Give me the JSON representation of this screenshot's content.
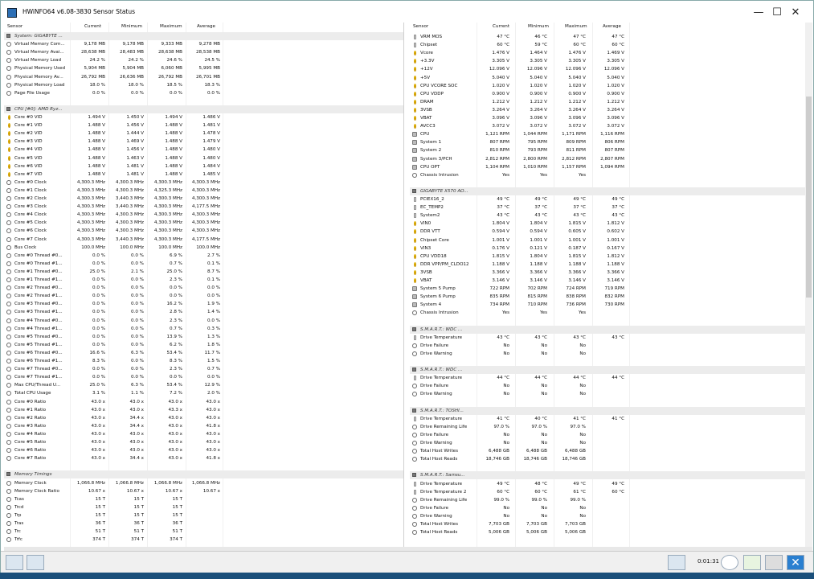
{
  "window": {
    "title": "HWiNFO64 v6.08-3830 Sensor Status",
    "min": "—",
    "max": "☐",
    "close": "✕"
  },
  "headers": [
    "Sensor",
    "Current",
    "Minimum",
    "Maximum",
    "Average"
  ],
  "left": [
    [
      "g",
      "System: GIGABYTE ..."
    ],
    [
      "c",
      "Virtual Memory Com...",
      "9,178 MB",
      "9,178 MB",
      "9,333 MB",
      "9,278 MB"
    ],
    [
      "c",
      "Virtual Memory Avai...",
      "28,638 MB",
      "28,483 MB",
      "28,638 MB",
      "28,538 MB"
    ],
    [
      "c",
      "Virtual Memory Load",
      "24.2 %",
      "24.2 %",
      "24.6 %",
      "24.5 %"
    ],
    [
      "c",
      "Physical Memory Used",
      "5,904 MB",
      "5,904 MB",
      "6,060 MB",
      "5,995 MB"
    ],
    [
      "c",
      "Physical Memory Av...",
      "26,792 MB",
      "26,636 MB",
      "26,792 MB",
      "26,701 MB"
    ],
    [
      "c",
      "Physical Memory Load",
      "18.0 %",
      "18.0 %",
      "18.5 %",
      "18.3 %"
    ],
    [
      "c",
      "Page File Usage",
      "0.0 %",
      "0.0 %",
      "0.0 %",
      "0.0 %"
    ],
    [
      "b"
    ],
    [
      "g",
      "CPU [#0]: AMD Ryz..."
    ],
    [
      "v",
      "Core #0 VID",
      "1.494 V",
      "1.450 V",
      "1.494 V",
      "1.486 V"
    ],
    [
      "v",
      "Core #1 VID",
      "1.488 V",
      "1.456 V",
      "1.488 V",
      "1.481 V"
    ],
    [
      "v",
      "Core #2 VID",
      "1.488 V",
      "1.444 V",
      "1.488 V",
      "1.478 V"
    ],
    [
      "v",
      "Core #3 VID",
      "1.488 V",
      "1.469 V",
      "1.488 V",
      "1.479 V"
    ],
    [
      "v",
      "Core #4 VID",
      "1.488 V",
      "1.456 V",
      "1.488 V",
      "1.480 V"
    ],
    [
      "v",
      "Core #5 VID",
      "1.488 V",
      "1.463 V",
      "1.488 V",
      "1.480 V"
    ],
    [
      "v",
      "Core #6 VID",
      "1.488 V",
      "1.481 V",
      "1.488 V",
      "1.484 V"
    ],
    [
      "v",
      "Core #7 VID",
      "1.488 V",
      "1.481 V",
      "1.488 V",
      "1.485 V"
    ],
    [
      "c",
      "Core #0 Clock",
      "4,300.3 MHz",
      "4,300.3 MHz",
      "4,300.3 MHz",
      "4,300.3 MHz"
    ],
    [
      "c",
      "Core #1 Clock",
      "4,300.3 MHz",
      "4,300.3 MHz",
      "4,325.3 MHz",
      "4,300.3 MHz"
    ],
    [
      "c",
      "Core #2 Clock",
      "4,300.3 MHz",
      "3,440.3 MHz",
      "4,300.3 MHz",
      "4,300.3 MHz"
    ],
    [
      "c",
      "Core #3 Clock",
      "4,300.3 MHz",
      "3,440.3 MHz",
      "4,300.3 MHz",
      "4,177.5 MHz"
    ],
    [
      "c",
      "Core #4 Clock",
      "4,300.3 MHz",
      "4,300.3 MHz",
      "4,300.3 MHz",
      "4,300.3 MHz"
    ],
    [
      "c",
      "Core #5 Clock",
      "4,300.3 MHz",
      "4,300.3 MHz",
      "4,300.3 MHz",
      "4,300.3 MHz"
    ],
    [
      "c",
      "Core #6 Clock",
      "4,300.3 MHz",
      "4,300.3 MHz",
      "4,300.3 MHz",
      "4,300.3 MHz"
    ],
    [
      "c",
      "Core #7 Clock",
      "4,300.3 MHz",
      "3,440.3 MHz",
      "4,300.3 MHz",
      "4,177.5 MHz"
    ],
    [
      "c",
      "Bus Clock",
      "100.0 MHz",
      "100.0 MHz",
      "100.0 MHz",
      "100.0 MHz"
    ],
    [
      "c",
      "Core #0 Thread #0...",
      "0.0 %",
      "0.0 %",
      "6.9 %",
      "2.7 %"
    ],
    [
      "c",
      "Core #0 Thread #1...",
      "0.0 %",
      "0.0 %",
      "0.7 %",
      "0.1 %"
    ],
    [
      "c",
      "Core #1 Thread #0...",
      "25.0 %",
      "2.1 %",
      "25.0 %",
      "8.7 %"
    ],
    [
      "c",
      "Core #1 Thread #1...",
      "0.0 %",
      "0.0 %",
      "2.3 %",
      "0.1 %"
    ],
    [
      "c",
      "Core #2 Thread #0...",
      "0.0 %",
      "0.0 %",
      "0.0 %",
      "0.0 %"
    ],
    [
      "c",
      "Core #2 Thread #1...",
      "0.0 %",
      "0.0 %",
      "0.0 %",
      "0.0 %"
    ],
    [
      "c",
      "Core #3 Thread #0...",
      "0.0 %",
      "0.0 %",
      "16.2 %",
      "1.9 %"
    ],
    [
      "c",
      "Core #3 Thread #1...",
      "0.0 %",
      "0.0 %",
      "2.8 %",
      "1.4 %"
    ],
    [
      "c",
      "Core #4 Thread #0...",
      "0.0 %",
      "0.0 %",
      "2.3 %",
      "0.0 %"
    ],
    [
      "c",
      "Core #4 Thread #1...",
      "0.0 %",
      "0.0 %",
      "0.7 %",
      "0.3 %"
    ],
    [
      "c",
      "Core #5 Thread #0...",
      "0.0 %",
      "0.0 %",
      "13.9 %",
      "1.3 %"
    ],
    [
      "c",
      "Core #5 Thread #1...",
      "0.0 %",
      "0.0 %",
      "6.2 %",
      "1.8 %"
    ],
    [
      "c",
      "Core #6 Thread #0...",
      "16.6 %",
      "6.3 %",
      "53.4 %",
      "11.7 %"
    ],
    [
      "c",
      "Core #6 Thread #1...",
      "8.3 %",
      "0.0 %",
      "8.3 %",
      "1.5 %"
    ],
    [
      "c",
      "Core #7 Thread #0...",
      "0.0 %",
      "0.0 %",
      "2.3 %",
      "0.7 %"
    ],
    [
      "c",
      "Core #7 Thread #1...",
      "0.0 %",
      "0.0 %",
      "0.0 %",
      "0.0 %"
    ],
    [
      "c",
      "Max CPU/Thread U...",
      "25.0 %",
      "6.3 %",
      "53.4 %",
      "12.9 %"
    ],
    [
      "c",
      "Total CPU Usage",
      "3.1 %",
      "1.1 %",
      "7.2 %",
      "2.0 %"
    ],
    [
      "c",
      "Core #0 Ratio",
      "43.0 x",
      "43.0 x",
      "43.0 x",
      "43.0 x"
    ],
    [
      "c",
      "Core #1 Ratio",
      "43.0 x",
      "43.0 x",
      "43.3 x",
      "43.0 x"
    ],
    [
      "c",
      "Core #2 Ratio",
      "43.0 x",
      "34.4 x",
      "43.0 x",
      "43.0 x"
    ],
    [
      "c",
      "Core #3 Ratio",
      "43.0 x",
      "34.4 x",
      "43.0 x",
      "41.8 x"
    ],
    [
      "c",
      "Core #4 Ratio",
      "43.0 x",
      "43.0 x",
      "43.0 x",
      "43.0 x"
    ],
    [
      "c",
      "Core #5 Ratio",
      "43.0 x",
      "43.0 x",
      "43.0 x",
      "43.0 x"
    ],
    [
      "c",
      "Core #6 Ratio",
      "43.0 x",
      "43.0 x",
      "43.0 x",
      "43.0 x"
    ],
    [
      "c",
      "Core #7 Ratio",
      "43.0 x",
      "34.4 x",
      "43.0 x",
      "41.8 x"
    ],
    [
      "b"
    ],
    [
      "g",
      "Memory Timings"
    ],
    [
      "c",
      "Memory Clock",
      "1,066.8 MHz",
      "1,066.8 MHz",
      "1,066.8 MHz",
      "1,066.8 MHz"
    ],
    [
      "c",
      "Memory Clock Ratio",
      "10.67 x",
      "10.67 x",
      "10.67 x",
      "10.67 x"
    ],
    [
      "c",
      "Tcas",
      "15 T",
      "15 T",
      "15 T",
      ""
    ],
    [
      "c",
      "Trcd",
      "15 T",
      "15 T",
      "15 T",
      ""
    ],
    [
      "c",
      "Trp",
      "15 T",
      "15 T",
      "15 T",
      ""
    ],
    [
      "c",
      "Tras",
      "36 T",
      "36 T",
      "36 T",
      ""
    ],
    [
      "c",
      "Trc",
      "51 T",
      "51 T",
      "51 T",
      ""
    ],
    [
      "c",
      "Trfc",
      "374 T",
      "374 T",
      "374 T",
      ""
    ]
  ],
  "right": [
    [
      "t",
      "VRM MOS",
      "47 °C",
      "46 °C",
      "47 °C",
      "47 °C"
    ],
    [
      "t",
      "Chipset",
      "60 °C",
      "59 °C",
      "60 °C",
      "60 °C"
    ],
    [
      "v",
      "Vcore",
      "1.476 V",
      "1.464 V",
      "1.476 V",
      "1.469 V"
    ],
    [
      "v",
      "+3.3V",
      "3.305 V",
      "3.305 V",
      "3.305 V",
      "3.305 V"
    ],
    [
      "v",
      "+12V",
      "12.096 V",
      "12.096 V",
      "12.096 V",
      "12.096 V"
    ],
    [
      "v",
      "+5V",
      "5.040 V",
      "5.040 V",
      "5.040 V",
      "5.040 V"
    ],
    [
      "v",
      "CPU VCORE SOC",
      "1.020 V",
      "1.020 V",
      "1.020 V",
      "1.020 V"
    ],
    [
      "v",
      "CPU VDDP",
      "0.900 V",
      "0.900 V",
      "0.900 V",
      "0.900 V"
    ],
    [
      "v",
      "DRAM",
      "1.212 V",
      "1.212 V",
      "1.212 V",
      "1.212 V"
    ],
    [
      "v",
      "3VSB",
      "3.264 V",
      "3.264 V",
      "3.264 V",
      "3.264 V"
    ],
    [
      "v",
      "VBAT",
      "3.096 V",
      "3.096 V",
      "3.096 V",
      "3.096 V"
    ],
    [
      "v",
      "AVCC3",
      "3.072 V",
      "3.072 V",
      "3.072 V",
      "3.072 V"
    ],
    [
      "f",
      "CPU",
      "1,121 RPM",
      "1,044 RPM",
      "1,171 RPM",
      "1,116 RPM"
    ],
    [
      "f",
      "System 1",
      "807 RPM",
      "795 RPM",
      "809 RPM",
      "806 RPM"
    ],
    [
      "f",
      "System 2",
      "810 RPM",
      "793 RPM",
      "811 RPM",
      "807 RPM"
    ],
    [
      "f",
      "System 3/PCH",
      "2,812 RPM",
      "2,800 RPM",
      "2,812 RPM",
      "2,807 RPM"
    ],
    [
      "f",
      "CPU OPT",
      "1,104 RPM",
      "1,010 RPM",
      "1,157 RPM",
      "1,094 RPM"
    ],
    [
      "c",
      "Chassis Intrusion",
      "Yes",
      "Yes",
      "Yes",
      ""
    ],
    [
      "b"
    ],
    [
      "g",
      "GIGABYTE X570 AO..."
    ],
    [
      "t",
      "PCIEX16_2",
      "49 °C",
      "49 °C",
      "49 °C",
      "49 °C"
    ],
    [
      "t",
      "EC_TEMP2",
      "37 °C",
      "37 °C",
      "37 °C",
      "37 °C"
    ],
    [
      "t",
      "System2",
      "43 °C",
      "43 °C",
      "43 °C",
      "43 °C"
    ],
    [
      "v",
      "VIN0",
      "1.804 V",
      "1.804 V",
      "1.815 V",
      "1.812 V"
    ],
    [
      "v",
      "DDR VTT",
      "0.594 V",
      "0.594 V",
      "0.605 V",
      "0.602 V"
    ],
    [
      "v",
      "Chipset Core",
      "1.001 V",
      "1.001 V",
      "1.001 V",
      "1.001 V"
    ],
    [
      "v",
      "VIN3",
      "0.176 V",
      "0.121 V",
      "0.187 V",
      "0.167 V"
    ],
    [
      "v",
      "CPU VDD18",
      "1.815 V",
      "1.804 V",
      "1.815 V",
      "1.812 V"
    ],
    [
      "v",
      "DDR VPP/PM_CLDO12",
      "1.188 V",
      "1.188 V",
      "1.188 V",
      "1.188 V"
    ],
    [
      "v",
      "3VSB",
      "3.366 V",
      "3.366 V",
      "3.366 V",
      "3.366 V"
    ],
    [
      "v",
      "VBAT",
      "3.146 V",
      "3.146 V",
      "3.146 V",
      "3.146 V"
    ],
    [
      "f",
      "System 5 Pump",
      "722 RPM",
      "702 RPM",
      "724 RPM",
      "719 RPM"
    ],
    [
      "f",
      "System 6 Pump",
      "835 RPM",
      "815 RPM",
      "838 RPM",
      "832 RPM"
    ],
    [
      "f",
      "System 4",
      "734 RPM",
      "710 RPM",
      "736 RPM",
      "730 RPM"
    ],
    [
      "c",
      "Chassis Intrusion",
      "Yes",
      "Yes",
      "Yes",
      ""
    ],
    [
      "b"
    ],
    [
      "g",
      "S.M.A.R.T.: WDC ..."
    ],
    [
      "t",
      "Drive Temperature",
      "43 °C",
      "43 °C",
      "43 °C",
      "43 °C"
    ],
    [
      "c",
      "Drive Failure",
      "No",
      "No",
      "No",
      ""
    ],
    [
      "c",
      "Drive Warning",
      "No",
      "No",
      "No",
      ""
    ],
    [
      "b"
    ],
    [
      "g",
      "S.M.A.R.T.: WDC ..."
    ],
    [
      "t",
      "Drive Temperature",
      "44 °C",
      "44 °C",
      "44 °C",
      "44 °C"
    ],
    [
      "c",
      "Drive Failure",
      "No",
      "No",
      "No",
      ""
    ],
    [
      "c",
      "Drive Warning",
      "No",
      "No",
      "No",
      ""
    ],
    [
      "b"
    ],
    [
      "g",
      "S.M.A.R.T.: TOSHI..."
    ],
    [
      "t",
      "Drive Temperature",
      "41 °C",
      "40 °C",
      "41 °C",
      "41 °C"
    ],
    [
      "c",
      "Drive Remaining Life",
      "97.0 %",
      "97.0 %",
      "97.0 %",
      ""
    ],
    [
      "c",
      "Drive Failure",
      "No",
      "No",
      "No",
      ""
    ],
    [
      "c",
      "Drive Warning",
      "No",
      "No",
      "No",
      ""
    ],
    [
      "c",
      "Total Host Writes",
      "6,488 GB",
      "6,488 GB",
      "6,488 GB",
      ""
    ],
    [
      "c",
      "Total Host Reads",
      "18,746 GB",
      "18,746 GB",
      "18,746 GB",
      ""
    ],
    [
      "b"
    ],
    [
      "g",
      "S.M.A.R.T.: Samsu..."
    ],
    [
      "t",
      "Drive Temperature",
      "49 °C",
      "48 °C",
      "49 °C",
      "49 °C"
    ],
    [
      "t",
      "Drive Temperature 2",
      "60 °C",
      "60 °C",
      "61 °C",
      "60 °C"
    ],
    [
      "c",
      "Drive Remaining Life",
      "99.0 %",
      "99.0 %",
      "99.0 %",
      ""
    ],
    [
      "c",
      "Drive Failure",
      "No",
      "No",
      "No",
      ""
    ],
    [
      "c",
      "Drive Warning",
      "No",
      "No",
      "No",
      ""
    ],
    [
      "c",
      "Total Host Writes",
      "7,703 GB",
      "7,703 GB",
      "7,703 GB",
      ""
    ],
    [
      "c",
      "Total Host Reads",
      "5,006 GB",
      "5,006 GB",
      "5,006 GB",
      ""
    ]
  ],
  "status": {
    "timer": "0:01:31"
  }
}
